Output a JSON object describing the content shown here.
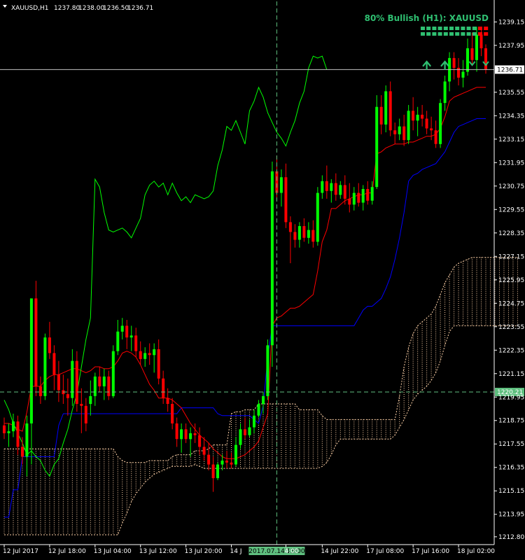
{
  "chart_data": {
    "type": "candlestick",
    "symbol": "XAUUSD,H1",
    "header_values": [
      "1237.80",
      "1238.00",
      "1236.50",
      "1236.71"
    ],
    "signal_text": "80% Bullish (H1): XAUUSD",
    "y_ticks": [
      "1239.15",
      "1237.95",
      "1236.71",
      "1235.55",
      "1234.35",
      "1233.15",
      "1231.95",
      "1230.75",
      "1229.55",
      "1228.35",
      "1227.15",
      "1225.95",
      "1224.75",
      "1223.55",
      "1222.35",
      "1221.15",
      "1220.21",
      "1219.95",
      "1218.75",
      "1217.55",
      "1216.35",
      "1215.15",
      "1213.95",
      "1212.80"
    ],
    "x_ticks": [
      "12 Jul 2017",
      "12 Jul 18:00",
      "13 Jul 04:00",
      "13 Jul 12:00",
      "13 Jul 20:00",
      "14 J",
      "2017.07.14 13:00",
      "4:00",
      "14 Jul 22:00",
      "17 Jul 08:00",
      "17 Jul 16:00",
      "18 Jul 02:00"
    ],
    "ylim": [
      1212.4,
      1240.2
    ],
    "current_price": 1236.71,
    "crosshair_price": 1220.21,
    "crosshair_time": "2017.07.14 13:00",
    "colors": {
      "bull": "#00ff00",
      "bear": "#ff0000",
      "kijun": "#0000ff",
      "tenkan": "#ff0000",
      "chikou": "#00ff00",
      "cloud": "#ffd2a8",
      "crosshair": "#5fbf7f",
      "signal": "#2fbf71",
      "grid_line": "#c0c0c0",
      "dots_red": "#ff0000",
      "dots_green": "#2fbf71"
    },
    "candles": [
      [
        1218.5,
        1218.9,
        1217.8,
        1218.1
      ],
      [
        1218.1,
        1218.6,
        1217.4,
        1218.2
      ],
      [
        1218.2,
        1219.1,
        1217.9,
        1218.7
      ],
      [
        1218.7,
        1219.0,
        1217.0,
        1217.4
      ],
      [
        1217.4,
        1217.9,
        1216.5,
        1216.9
      ],
      [
        1216.9,
        1219.0,
        1215.9,
        1218.6
      ],
      [
        1218.6,
        1223.5,
        1216.5,
        1225.0
      ],
      [
        1225.0,
        1225.9,
        1220.0,
        1220.5
      ],
      [
        1220.5,
        1221.0,
        1219.6,
        1220.0
      ],
      [
        1220.0,
        1223.2,
        1219.8,
        1223.0
      ],
      [
        1223.0,
        1223.8,
        1221.9,
        1222.2
      ],
      [
        1222.2,
        1222.6,
        1220.3,
        1221.1
      ],
      [
        1221.1,
        1221.8,
        1219.7,
        1220.3
      ],
      [
        1220.3,
        1221.1,
        1219.6,
        1220.1
      ],
      [
        1220.1,
        1220.9,
        1219.0,
        1219.9
      ],
      [
        1219.9,
        1222.4,
        1219.5,
        1221.8
      ],
      [
        1221.8,
        1222.3,
        1219.2,
        1219.6
      ],
      [
        1219.6,
        1220.4,
        1218.1,
        1219.5
      ],
      [
        1219.5,
        1219.9,
        1218.2,
        1218.6
      ],
      [
        1219.6,
        1220.8,
        1219.0,
        1220.0
      ],
      [
        1220.0,
        1221.2,
        1219.5,
        1221.0
      ],
      [
        1221.0,
        1221.5,
        1220.2,
        1220.5
      ],
      [
        1220.5,
        1221.4,
        1219.8,
        1221.0
      ],
      [
        1221.0,
        1221.3,
        1219.8,
        1220.0
      ],
      [
        1220.0,
        1222.6,
        1219.9,
        1222.3
      ],
      [
        1222.3,
        1223.9,
        1222.1,
        1223.3
      ],
      [
        1223.3,
        1224.0,
        1222.9,
        1223.6
      ],
      [
        1223.6,
        1223.9,
        1222.4,
        1223.0
      ],
      [
        1223.0,
        1223.6,
        1222.3,
        1223.1
      ],
      [
        1223.1,
        1223.5,
        1222.0,
        1222.3
      ],
      [
        1222.3,
        1222.8,
        1221.6,
        1221.9
      ],
      [
        1221.9,
        1222.5,
        1221.5,
        1222.2
      ],
      [
        1222.2,
        1222.7,
        1221.6,
        1222.1
      ],
      [
        1222.1,
        1222.7,
        1221.2,
        1222.4
      ],
      [
        1222.4,
        1222.9,
        1220.6,
        1220.9
      ],
      [
        1220.9,
        1221.3,
        1219.6,
        1219.9
      ],
      [
        1219.9,
        1220.4,
        1219.2,
        1219.6
      ],
      [
        1219.6,
        1219.9,
        1218.3,
        1218.6
      ],
      [
        1218.6,
        1218.9,
        1217.4,
        1217.8
      ],
      [
        1217.8,
        1218.6,
        1217.1,
        1218.3
      ],
      [
        1218.3,
        1218.6,
        1217.6,
        1217.8
      ],
      [
        1217.8,
        1218.4,
        1216.9,
        1218.1
      ],
      [
        1218.1,
        1218.6,
        1217.6,
        1218.0
      ],
      [
        1218.0,
        1218.4,
        1217.0,
        1217.4
      ],
      [
        1217.4,
        1217.9,
        1216.7,
        1217.0
      ],
      [
        1217.0,
        1217.6,
        1216.2,
        1216.5
      ],
      [
        1216.5,
        1216.9,
        1215.1,
        1215.8
      ],
      [
        1215.8,
        1216.6,
        1215.7,
        1216.5
      ],
      [
        1216.5,
        1217.0,
        1216.2,
        1216.7
      ],
      [
        1216.7,
        1217.2,
        1216.3,
        1216.6
      ],
      [
        1216.6,
        1217.1,
        1216.3,
        1216.5
      ],
      [
        1216.5,
        1217.9,
        1216.4,
        1217.5
      ],
      [
        1217.5,
        1218.6,
        1217.3,
        1218.3
      ],
      [
        1218.3,
        1218.9,
        1217.8,
        1218.0
      ],
      [
        1218.0,
        1218.8,
        1217.9,
        1218.4
      ],
      [
        1218.4,
        1219.3,
        1218.1,
        1219.0
      ],
      [
        1219.0,
        1219.8,
        1218.9,
        1219.6
      ],
      [
        1219.6,
        1220.2,
        1219.1,
        1220.0
      ],
      [
        1220.0,
        1222.9,
        1219.8,
        1222.6
      ],
      [
        1222.6,
        1232.0,
        1221.5,
        1231.5
      ],
      [
        1231.5,
        1232.3,
        1230.0,
        1230.4
      ],
      [
        1230.4,
        1231.6,
        1229.7,
        1231.2
      ],
      [
        1231.2,
        1231.9,
        1228.6,
        1228.9
      ],
      [
        1228.9,
        1229.2,
        1226.8,
        1228.4
      ],
      [
        1228.4,
        1228.8,
        1227.6,
        1228.0
      ],
      [
        1228.0,
        1228.9,
        1227.6,
        1228.7
      ],
      [
        1228.7,
        1229.1,
        1227.9,
        1228.1
      ],
      [
        1228.1,
        1228.9,
        1227.8,
        1228.5
      ],
      [
        1228.5,
        1229.0,
        1227.6,
        1227.9
      ],
      [
        1227.9,
        1230.7,
        1227.7,
        1230.4
      ],
      [
        1230.4,
        1231.3,
        1230.1,
        1231.0
      ],
      [
        1231.0,
        1231.8,
        1230.1,
        1230.5
      ],
      [
        1230.5,
        1231.1,
        1229.9,
        1230.9
      ],
      [
        1230.9,
        1231.4,
        1230.0,
        1230.3
      ],
      [
        1230.3,
        1231.0,
        1230.1,
        1230.8
      ],
      [
        1230.8,
        1231.3,
        1229.8,
        1230.1
      ],
      [
        1230.1,
        1230.9,
        1229.4,
        1229.8
      ],
      [
        1229.8,
        1230.7,
        1229.5,
        1230.4
      ],
      [
        1230.4,
        1230.9,
        1229.7,
        1229.9
      ],
      [
        1229.9,
        1230.8,
        1229.5,
        1230.6
      ],
      [
        1230.6,
        1231.0,
        1229.8,
        1230.0
      ],
      [
        1230.0,
        1231.0,
        1229.8,
        1230.7
      ],
      [
        1230.7,
        1235.4,
        1230.6,
        1234.8
      ],
      [
        1234.8,
        1235.4,
        1233.4,
        1233.9
      ],
      [
        1233.9,
        1235.9,
        1233.5,
        1235.6
      ],
      [
        1235.6,
        1236.1,
        1233.3,
        1233.6
      ],
      [
        1233.6,
        1234.0,
        1232.9,
        1233.4
      ],
      [
        1233.4,
        1234.2,
        1233.1,
        1233.8
      ],
      [
        1233.8,
        1234.4,
        1232.8,
        1233.1
      ],
      [
        1233.1,
        1234.9,
        1232.9,
        1234.6
      ],
      [
        1234.6,
        1235.3,
        1233.6,
        1234.1
      ],
      [
        1234.1,
        1234.8,
        1233.3,
        1234.4
      ],
      [
        1234.4,
        1234.9,
        1233.8,
        1234.2
      ],
      [
        1234.2,
        1234.6,
        1233.4,
        1233.7
      ],
      [
        1233.7,
        1234.3,
        1233.1,
        1233.6
      ],
      [
        1233.6,
        1234.1,
        1232.7,
        1232.9
      ],
      [
        1232.9,
        1235.2,
        1232.7,
        1235.0
      ],
      [
        1235.0,
        1236.4,
        1234.6,
        1236.1
      ],
      [
        1236.1,
        1237.6,
        1235.6,
        1237.3
      ],
      [
        1237.3,
        1237.6,
        1236.2,
        1236.8
      ],
      [
        1236.8,
        1237.3,
        1235.9,
        1236.3
      ],
      [
        1236.3,
        1237.2,
        1235.8,
        1236.6
      ],
      [
        1236.6,
        1238.3,
        1236.4,
        1237.8
      ],
      [
        1237.8,
        1238.6,
        1236.9,
        1237.2
      ],
      [
        1237.2,
        1238.9,
        1236.6,
        1238.5
      ],
      [
        1238.5,
        1238.9,
        1237.4,
        1237.8
      ],
      [
        1237.8,
        1238.0,
        1236.5,
        1236.71
      ]
    ],
    "tenkan": [
      1218.6,
      1218.6,
      1218.5,
      1218.3,
      1218.2,
      1219.2,
      1220.5,
      1220.5,
      1220.5,
      1220.8,
      1221.0,
      1221.1,
      1221.1,
      1221.2,
      1221.3,
      1221.4,
      1221.4,
      1221.3,
      1221.2,
      1221.3,
      1221.5,
      1221.5,
      1221.4,
      1221.4,
      1221.5,
      1221.8,
      1222.2,
      1222.3,
      1222.2,
      1222.0,
      1221.6,
      1221.1,
      1220.6,
      1220.3,
      1219.9,
      1219.9,
      1219.9,
      1219.8,
      1219.6,
      1219.4,
      1219.0,
      1218.6,
      1218.3,
      1218.0,
      1217.8,
      1217.6,
      1217.3,
      1217.1,
      1216.9,
      1216.8,
      1216.8,
      1216.8,
      1216.9,
      1217.0,
      1217.2,
      1217.4,
      1217.7,
      1218.4,
      1219.1,
      1223.6,
      1224.0,
      1224.1,
      1224.3,
      1224.5,
      1224.5,
      1224.6,
      1224.8,
      1225.0,
      1225.2,
      1226.4,
      1227.9,
      1228.5,
      1229.6,
      1229.6,
      1229.8,
      1230.0,
      1230.1,
      1230.2,
      1230.3,
      1230.3,
      1230.4,
      1230.4,
      1232.4,
      1232.5,
      1232.7,
      1232.8,
      1232.9,
      1232.9,
      1232.9,
      1233.0,
      1233.0,
      1233.1,
      1233.2,
      1233.3,
      1233.3,
      1233.4,
      1233.7,
      1234.3,
      1235.1,
      1235.3,
      1235.4,
      1235.5,
      1235.6,
      1235.7,
      1235.8,
      1235.8,
      1235.8
    ],
    "kijun": [
      1213.8,
      1213.8,
      1215.2,
      1215.2,
      1216.9,
      1216.9,
      1216.9,
      1216.9,
      1216.9,
      1216.9,
      1216.9,
      1216.9,
      1218.5,
      1219.1,
      1219.1,
      1219.1,
      1219.1,
      1219.1,
      1219.1,
      1219.1,
      1219.1,
      1219.1,
      1219.1,
      1219.1,
      1219.1,
      1219.1,
      1219.1,
      1219.1,
      1219.1,
      1219.1,
      1219.1,
      1219.1,
      1219.1,
      1219.1,
      1219.1,
      1219.1,
      1219.1,
      1219.1,
      1219.1,
      1219.4,
      1219.4,
      1219.4,
      1219.4,
      1219.4,
      1219.4,
      1219.4,
      1219.4,
      1219.1,
      1219.0,
      1219.0,
      1219.0,
      1219.0,
      1219.0,
      1219.0,
      1219.0,
      1218.8,
      1218.6,
      1219.5,
      1222.0,
      1223.6,
      1223.6,
      1223.6,
      1223.6,
      1223.6,
      1223.6,
      1223.6,
      1223.6,
      1223.6,
      1223.6,
      1223.6,
      1223.6,
      1223.6,
      1223.6,
      1223.6,
      1223.6,
      1223.6,
      1223.6,
      1223.6,
      1224.0,
      1224.4,
      1224.6,
      1224.6,
      1224.8,
      1225.0,
      1225.5,
      1226.1,
      1227.0,
      1228.1,
      1229.4,
      1231.0,
      1231.3,
      1231.4,
      1231.6,
      1231.7,
      1231.8,
      1231.9,
      1232.2,
      1232.5,
      1233.0,
      1233.5,
      1233.8,
      1233.9,
      1234.0,
      1234.1,
      1234.2,
      1234.2,
      1234.2
    ],
    "chikou": [
      1219.8,
      1219.3,
      1218.6,
      1218.1,
      1217.6,
      1217.0,
      1217.2,
      1216.9,
      1216.7,
      1216.2,
      1215.9,
      1216.5,
      1216.8,
      1217.6,
      1218.3,
      1219.3,
      1220.1,
      1221.5,
      1222.9,
      1224.0,
      1231.1,
      1230.7,
      1229.4,
      1228.5,
      1228.4,
      1228.5,
      1228.6,
      1228.4,
      1228.1,
      1228.6,
      1229.1,
      1230.3,
      1230.8,
      1231.0,
      1230.7,
      1230.9,
      1230.3,
      1230.9,
      1230.4,
      1230.0,
      1230.2,
      1229.9,
      1230.3,
      1230.2,
      1230.1,
      1230.2,
      1230.5,
      1231.8,
      1232.6,
      1233.8,
      1233.6,
      1234.1,
      1233.5,
      1232.9,
      1234.6,
      1235.1,
      1235.8,
      1235.3,
      1234.5,
      1234.0,
      1233.5,
      1233.2,
      1232.8,
      1233.5,
      1234.1,
      1235.0,
      1235.6,
      1236.8,
      1237.4,
      1237.3,
      1237.4,
      1236.71
    ],
    "cloud": [
      [
        1217.3,
        1212.9
      ],
      [
        1217.3,
        1212.9
      ],
      [
        1217.3,
        1212.9
      ],
      [
        1217.3,
        1212.9
      ],
      [
        1217.3,
        1212.9
      ],
      [
        1217.3,
        1212.9
      ],
      [
        1217.3,
        1212.9
      ],
      [
        1217.3,
        1212.9
      ],
      [
        1217.3,
        1212.9
      ],
      [
        1217.3,
        1212.9
      ],
      [
        1217.3,
        1212.9
      ],
      [
        1217.3,
        1212.9
      ],
      [
        1217.3,
        1212.9
      ],
      [
        1217.3,
        1212.9
      ],
      [
        1217.3,
        1212.9
      ],
      [
        1217.3,
        1212.9
      ],
      [
        1217.3,
        1212.9
      ],
      [
        1217.3,
        1212.9
      ],
      [
        1217.3,
        1212.9
      ],
      [
        1217.3,
        1212.9
      ],
      [
        1217.3,
        1212.9
      ],
      [
        1217.3,
        1212.9
      ],
      [
        1217.3,
        1212.9
      ],
      [
        1217.3,
        1212.9
      ],
      [
        1217.3,
        1212.9
      ],
      [
        1216.9,
        1212.9
      ],
      [
        1216.7,
        1213.5
      ],
      [
        1216.6,
        1214.0
      ],
      [
        1216.6,
        1214.6
      ],
      [
        1216.6,
        1215.0
      ],
      [
        1216.6,
        1215.3
      ],
      [
        1216.6,
        1215.6
      ],
      [
        1216.7,
        1215.8
      ],
      [
        1216.7,
        1216.0
      ],
      [
        1216.7,
        1216.1
      ],
      [
        1216.7,
        1216.2
      ],
      [
        1216.7,
        1216.3
      ],
      [
        1216.9,
        1216.4
      ],
      [
        1217.0,
        1216.4
      ],
      [
        1217.0,
        1216.4
      ],
      [
        1217.0,
        1216.4
      ],
      [
        1217.0,
        1216.4
      ],
      [
        1217.2,
        1216.5
      ],
      [
        1217.2,
        1216.4
      ],
      [
        1217.2,
        1216.3
      ],
      [
        1217.3,
        1216.3
      ],
      [
        1217.5,
        1216.3
      ],
      [
        1217.5,
        1216.3
      ],
      [
        1217.5,
        1216.3
      ],
      [
        1217.5,
        1216.3
      ],
      [
        1219.1,
        1216.3
      ],
      [
        1219.2,
        1216.3
      ],
      [
        1219.2,
        1216.3
      ],
      [
        1219.3,
        1216.3
      ],
      [
        1219.3,
        1216.3
      ],
      [
        1219.3,
        1216.3
      ],
      [
        1219.6,
        1216.3
      ],
      [
        1219.6,
        1216.3
      ],
      [
        1219.6,
        1216.3
      ],
      [
        1219.6,
        1216.3
      ],
      [
        1219.6,
        1216.3
      ],
      [
        1219.6,
        1216.3
      ],
      [
        1219.6,
        1216.3
      ],
      [
        1219.6,
        1216.3
      ],
      [
        1219.6,
        1216.3
      ],
      [
        1219.3,
        1216.3
      ],
      [
        1219.3,
        1216.3
      ],
      [
        1219.3,
        1216.3
      ],
      [
        1219.3,
        1216.3
      ],
      [
        1219.3,
        1216.3
      ],
      [
        1219.0,
        1216.4
      ],
      [
        1218.8,
        1216.6
      ],
      [
        1218.8,
        1217.0
      ],
      [
        1218.8,
        1217.5
      ],
      [
        1218.8,
        1217.8
      ],
      [
        1218.8,
        1217.8
      ],
      [
        1218.8,
        1217.8
      ],
      [
        1218.8,
        1217.8
      ],
      [
        1218.8,
        1217.8
      ],
      [
        1218.8,
        1217.8
      ],
      [
        1218.8,
        1217.8
      ],
      [
        1218.8,
        1217.8
      ],
      [
        1218.8,
        1217.8
      ],
      [
        1218.8,
        1217.8
      ],
      [
        1218.8,
        1217.8
      ],
      [
        1218.8,
        1217.8
      ],
      [
        1218.8,
        1218.0
      ],
      [
        1220.0,
        1218.4
      ],
      [
        1221.5,
        1218.8
      ],
      [
        1222.5,
        1219.3
      ],
      [
        1223.2,
        1219.8
      ],
      [
        1223.6,
        1220.1
      ],
      [
        1223.8,
        1220.3
      ],
      [
        1224.0,
        1220.5
      ],
      [
        1224.2,
        1220.8
      ],
      [
        1224.6,
        1221.2
      ],
      [
        1225.2,
        1221.8
      ],
      [
        1225.8,
        1222.6
      ],
      [
        1226.2,
        1223.3
      ],
      [
        1226.6,
        1223.6
      ],
      [
        1226.8,
        1223.6
      ],
      [
        1226.9,
        1223.6
      ],
      [
        1227.0,
        1223.6
      ],
      [
        1227.1,
        1223.6
      ],
      [
        1227.1,
        1223.6
      ],
      [
        1227.1,
        1223.6
      ],
      [
        1227.1,
        1223.6
      ],
      [
        1227.1,
        1223.6
      ],
      [
        1227.1,
        1223.6
      ],
      [
        1227.1,
        1223.6
      ],
      [
        1227.1,
        1223.6
      ],
      [
        1227.1,
        1223.6
      ],
      [
        1227.1,
        1223.6
      ],
      [
        1227.1,
        1223.6
      ]
    ],
    "arrows_up_at": [
      93,
      97
    ],
    "dots_rows": 2,
    "dots_cols": 12,
    "dots_red_cols": [
      11,
      12
    ]
  }
}
